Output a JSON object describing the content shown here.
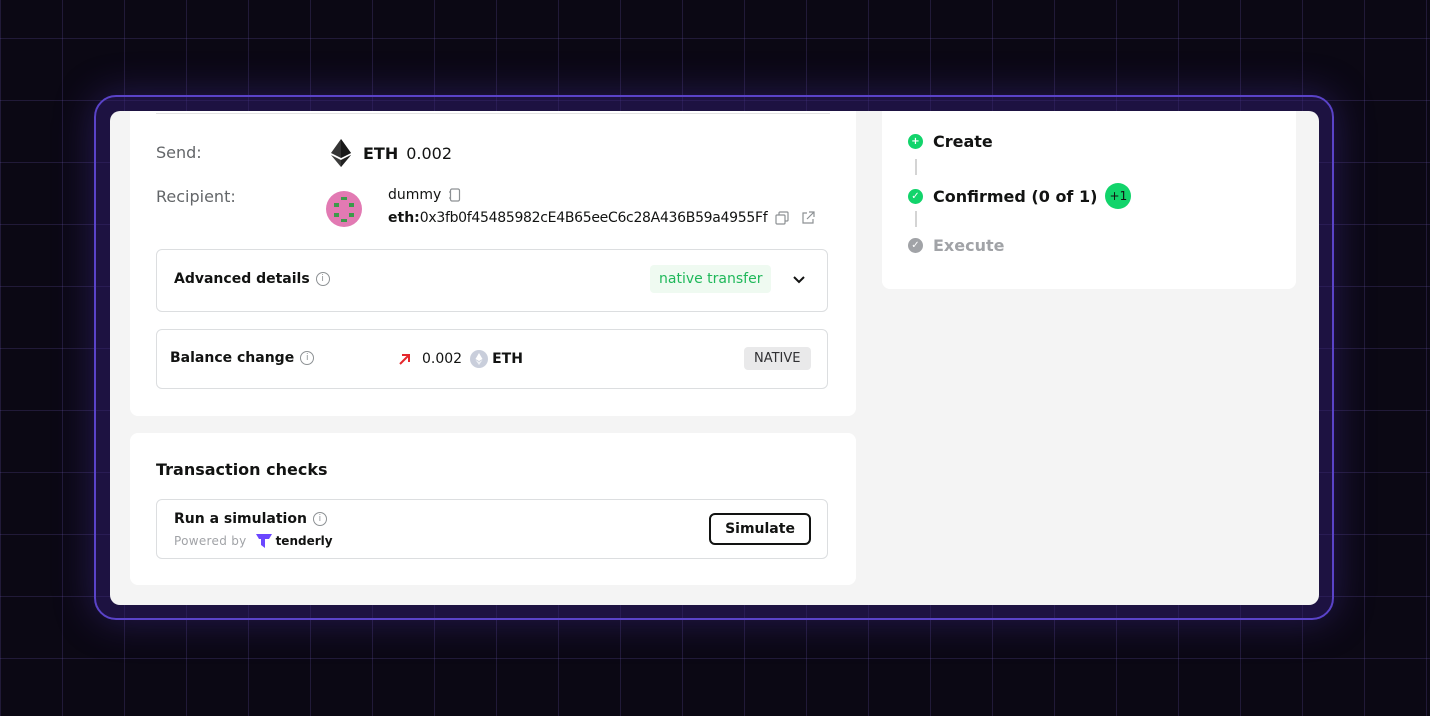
{
  "tx": {
    "send_label": "Send:",
    "token": "ETH",
    "amount": "0.002",
    "recipient_label": "Recipient:",
    "recipient_name": "dummy",
    "address_prefix": "eth:",
    "address": "0x3fb0f45485982cE4B65eeC6c28A436B59a4955Ff"
  },
  "advanced": {
    "label": "Advanced details",
    "badge": "native transfer"
  },
  "balance": {
    "label": "Balance change",
    "amount": "0.002",
    "token": "ETH",
    "badge": "NATIVE"
  },
  "checks": {
    "title": "Transaction checks",
    "sim_label": "Run a simulation",
    "powered": "Powered by",
    "provider": "tenderly",
    "button": "Simulate"
  },
  "status": {
    "steps": [
      {
        "label": "Create",
        "state": "done"
      },
      {
        "label": "Confirmed (0 of 1)",
        "state": "done",
        "badge": "+1"
      },
      {
        "label": "Execute",
        "state": "pending"
      }
    ]
  },
  "colors": {
    "accent_green": "#12d46b",
    "frame_border": "#5a43c8",
    "arrow_red": "#e5272c"
  }
}
